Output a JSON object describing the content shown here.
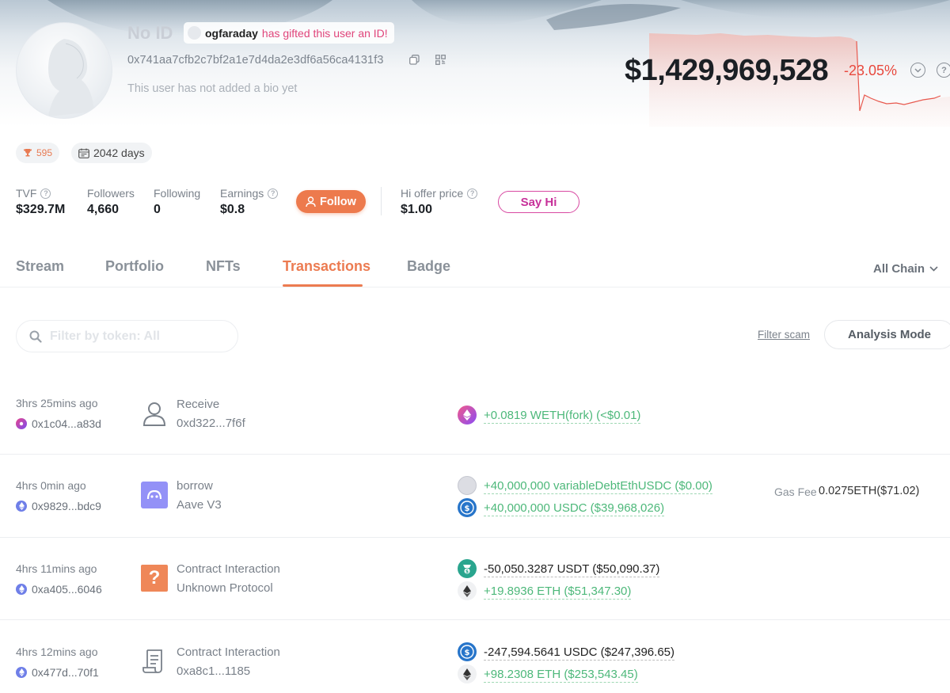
{
  "profile": {
    "name": "No ID",
    "gift_user": "ogfaraday",
    "gift_text": "has gifted this user an ID!",
    "address": "0x741aa7cfb2c7bf2a1e7d4da2e3df6a56ca4131f3",
    "bio": "This user has not added a bio yet",
    "net_worth": "$1,429,969,528",
    "net_worth_change": "-23.05%"
  },
  "badges": {
    "score": "595",
    "days": "2042 days"
  },
  "stats": {
    "tvf_label": "TVF",
    "tvf_value": "$329.7M",
    "followers_label": "Followers",
    "followers_value": "4,660",
    "following_label": "Following",
    "following_value": "0",
    "earnings_label": "Earnings",
    "earnings_value": "$0.8",
    "follow_label": "Follow",
    "hi_offer_label": "Hi offer price",
    "hi_offer_value": "$1.00",
    "say_hi_label": "Say Hi"
  },
  "tabs": [
    {
      "label": "Stream"
    },
    {
      "label": "Portfolio"
    },
    {
      "label": "NFTs"
    },
    {
      "label": "Transactions"
    },
    {
      "label": "Badge"
    }
  ],
  "active_tab": "Transactions",
  "chain_select": "All Chain",
  "filters": {
    "search_placeholder": "Filter by token: All",
    "filter_scam": "Filter scam",
    "analysis_mode": "Analysis Mode"
  },
  "transactions": [
    {
      "time": "3hrs 25mins ago",
      "hash": "0x1c04...a83d",
      "action": "Receive",
      "sub": "0xd322...7f6f",
      "tokens": [
        {
          "amount": "+0.0819 WETH(fork) (<$0.01)",
          "icon": "weth-fork-icon"
        }
      ]
    },
    {
      "time": "4hrs 0min ago",
      "hash": "0x9829...bdc9",
      "action": "borrow",
      "sub": "Aave V3",
      "tokens": [
        {
          "amount": "+40,000,000 variableDebtEthUSDC ($0.00)",
          "icon": "variable-debt-usdc-icon"
        },
        {
          "amount": "+40,000,000 USDC ($39,968,026)",
          "icon": "usdc-icon"
        }
      ],
      "gas_label": "Gas Fee",
      "gas_value": "0.0275ETH($71.02)"
    },
    {
      "time": "4hrs 11mins ago",
      "hash": "0xa405...6046",
      "action": "Contract Interaction",
      "sub": "Unknown Protocol",
      "tokens": [
        {
          "amount": "-50,050.3287 USDT ($50,090.37)",
          "icon": "usdt-icon"
        },
        {
          "amount": "+19.8936 ETH ($51,347.30)",
          "icon": "eth-icon"
        }
      ]
    },
    {
      "time": "4hrs 12mins ago",
      "hash": "0x477d...70f1",
      "action": "Contract Interaction",
      "sub": "0xa8c1...1185",
      "tokens": [
        {
          "amount": "-247,594.5641 USDC ($247,396.65)",
          "icon": "usdc-icon"
        },
        {
          "amount": "+98.2308 ETH ($253,543.45)",
          "icon": "eth-icon"
        }
      ]
    }
  ],
  "colors": {
    "accent": "#ec7b51",
    "positive": "#4db87a",
    "negative": "#e8493e",
    "say_hi": "#d84aa2"
  }
}
